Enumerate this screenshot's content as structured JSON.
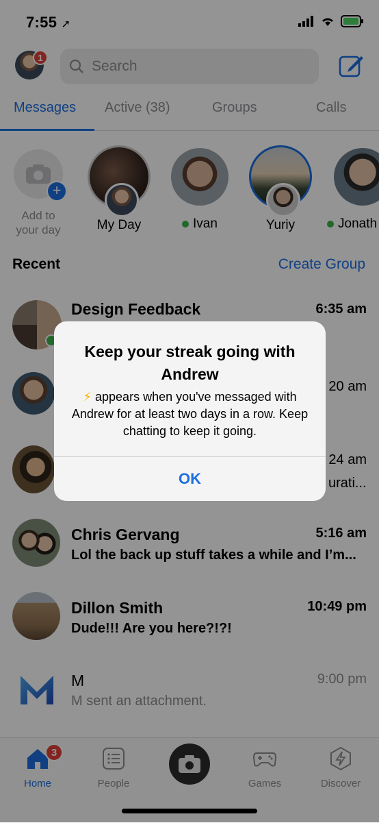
{
  "status_bar": {
    "time": "7:55"
  },
  "header": {
    "notification_count": "1",
    "search_placeholder": "Search"
  },
  "tabs": [
    {
      "label": "Messages",
      "active": true
    },
    {
      "label": "Active (38)"
    },
    {
      "label": "Groups"
    },
    {
      "label": "Calls"
    }
  ],
  "stories": [
    {
      "name": "Add to your day"
    },
    {
      "name": "My Day"
    },
    {
      "name": "Ivan",
      "online": true
    },
    {
      "name": "Yuriy"
    },
    {
      "name": "Jonath",
      "online": true
    }
  ],
  "recent": {
    "label": "Recent",
    "create_group": "Create Group"
  },
  "conversations": [
    {
      "title": "Design Feedback",
      "time": "6:35 am",
      "preview": ""
    },
    {
      "title": "",
      "time": "20 am",
      "preview": ""
    },
    {
      "title": "",
      "time": "24 am",
      "preview": "urati..."
    },
    {
      "title": "Chris Gervang",
      "time": "5:16 am",
      "preview": "Lol the back up stuff takes a while and I’m..."
    },
    {
      "title": "Dillon Smith",
      "time": "10:49 pm",
      "preview": "Dude!!! Are you here?!?!"
    },
    {
      "title": "M",
      "time": "9:00 pm",
      "preview": "M sent an attachment."
    }
  ],
  "tabbar": {
    "home_badge": "3",
    "items": [
      {
        "label": "Home",
        "icon": "home-icon",
        "active": true
      },
      {
        "label": "People",
        "icon": "people-icon"
      },
      {
        "label": "",
        "icon": "camera-icon"
      },
      {
        "label": "Games",
        "icon": "games-icon"
      },
      {
        "label": "Discover",
        "icon": "discover-icon"
      }
    ]
  },
  "dialog": {
    "title": "Keep your streak going with Andrew",
    "message_emoji": "⚡",
    "message": "appears when you've messaged with Andrew for at least two days in a row. Keep chatting to keep it going.",
    "ok_label": "OK"
  },
  "colors": {
    "accent": "#1c6fe0",
    "badge": "#e0413a",
    "online": "#3bb44a"
  }
}
